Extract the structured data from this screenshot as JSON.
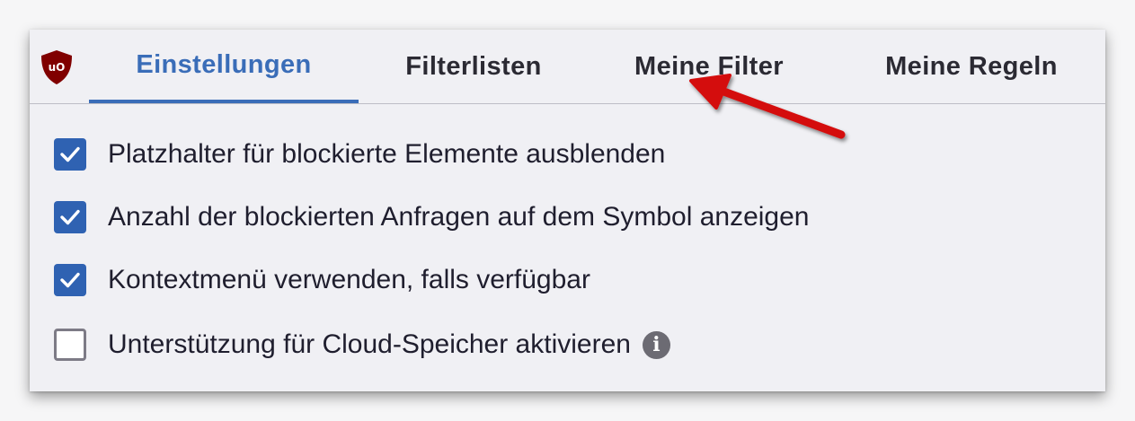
{
  "tabs": [
    {
      "label": "Einstellungen",
      "active": true
    },
    {
      "label": "Filterlisten",
      "active": false
    },
    {
      "label": "Meine Filter",
      "active": false
    },
    {
      "label": "Meine Regeln",
      "active": false
    }
  ],
  "logo": {
    "text": "uO",
    "icon": "ublock-origin-shield-icon",
    "color": "#800000"
  },
  "options": [
    {
      "label": "Platzhalter für blockierte Elemente ausblenden",
      "checked": true
    },
    {
      "label": "Anzahl der blockierten Anfragen auf dem Symbol anzeigen",
      "checked": true
    },
    {
      "label": "Kontextmenü verwenden, falls verfügbar",
      "checked": true
    },
    {
      "label": "Unterstützung für Cloud-Speicher aktivieren",
      "checked": false,
      "info_icon": "i"
    }
  ],
  "colors": {
    "accent": "#3a6db8",
    "checkbox": "#2f62b2",
    "annotation_arrow": "#d40c0c"
  }
}
